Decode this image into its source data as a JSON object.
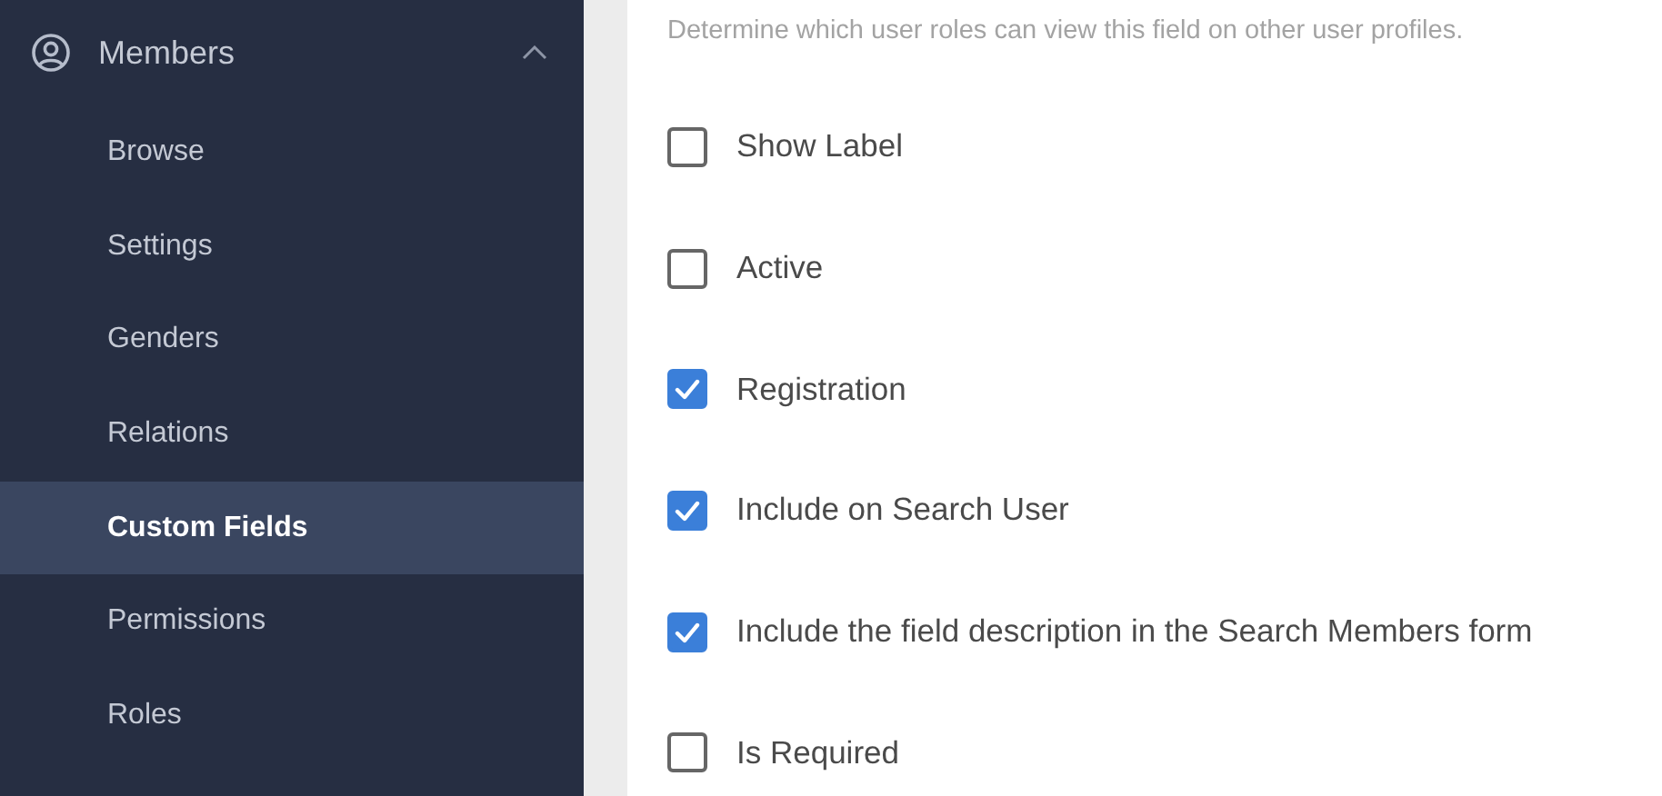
{
  "sidebar": {
    "section": {
      "label": "Members",
      "expanded": true
    },
    "items": [
      {
        "label": "Browse",
        "selected": false
      },
      {
        "label": "Settings",
        "selected": false
      },
      {
        "label": "Genders",
        "selected": false
      },
      {
        "label": "Relations",
        "selected": false
      },
      {
        "label": "Custom Fields",
        "selected": true
      },
      {
        "label": "Permissions",
        "selected": false
      },
      {
        "label": "Roles",
        "selected": false
      }
    ]
  },
  "content": {
    "description": "Determine which user roles can view this field on other user profiles.",
    "options": [
      {
        "label": "Show Label",
        "checked": false
      },
      {
        "label": "Active",
        "checked": false
      },
      {
        "label": "Registration",
        "checked": true
      },
      {
        "label": "Include on Search User",
        "checked": true
      },
      {
        "label": "Include the field description in the Search Members form",
        "checked": true
      },
      {
        "label": "Is Required",
        "checked": false
      }
    ]
  }
}
